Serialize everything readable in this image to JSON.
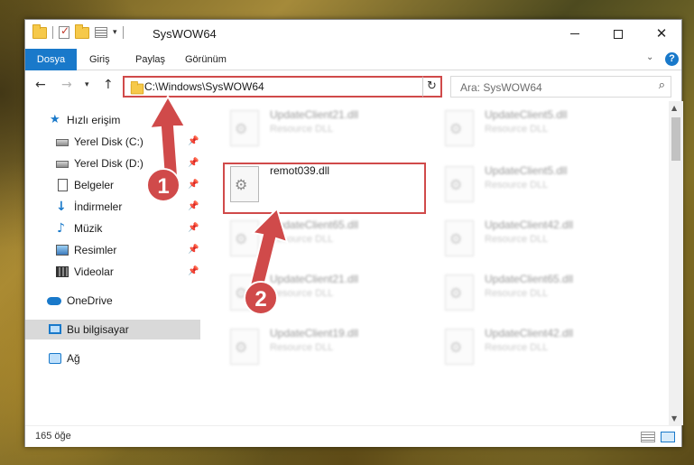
{
  "window": {
    "title": "SysWOW64",
    "minimize": "",
    "maximize": "",
    "close": "✕"
  },
  "ribbon": {
    "tabs": [
      "Dosya",
      "Giriş",
      "Paylaş",
      "Görünüm"
    ],
    "help": "?"
  },
  "navigation": {
    "address": "C:\\Windows\\SysWOW64",
    "search_placeholder": "Ara: SysWOW64"
  },
  "sidebar": {
    "quick_access": "Hızlı erişim",
    "items": [
      {
        "label": "Yerel Disk (C:)",
        "icon": "drive-icon",
        "pinned": true
      },
      {
        "label": "Yerel Disk (D:)",
        "icon": "drive-icon",
        "pinned": true
      },
      {
        "label": "Belgeler",
        "icon": "documents-icon",
        "pinned": true
      },
      {
        "label": "İndirmeler",
        "icon": "downloads-icon",
        "pinned": true
      },
      {
        "label": "Müzik",
        "icon": "music-icon",
        "pinned": true
      },
      {
        "label": "Resimler",
        "icon": "pictures-icon",
        "pinned": true
      },
      {
        "label": "Videolar",
        "icon": "videos-icon",
        "pinned": true
      }
    ],
    "onedrive": "OneDrive",
    "this_pc": "Bu bilgisayar",
    "network": "Ağ"
  },
  "files": {
    "left": [
      {
        "name": "UpdateClient21.dll",
        "type": "Resource DLL"
      },
      {
        "name": "remot039.dll",
        "type": ""
      },
      {
        "name": "UpdateClient65.dll",
        "type": "Resource DLL"
      },
      {
        "name": "UpdateClient21.dll",
        "type": "Resource DLL"
      },
      {
        "name": "UpdateClient19.dll",
        "type": "Resource DLL"
      }
    ],
    "right": [
      {
        "name": "UpdateClient5.dll",
        "type": "Resource DLL"
      },
      {
        "name": "UpdateClient5.dll",
        "type": "Resource DLL"
      },
      {
        "name": "UpdateClient42.dll",
        "type": "Resource DLL"
      },
      {
        "name": "UpdateClient65.dll",
        "type": "Resource DLL"
      },
      {
        "name": "UpdateClient42.dll",
        "type": "Resource DLL"
      }
    ]
  },
  "status": {
    "item_count": "165 öğe"
  },
  "annotations": {
    "step1": "1",
    "step2": "2",
    "color": "#d04a4a"
  },
  "colors": {
    "accent": "#1979ca",
    "highlight": "#d04a4a"
  }
}
